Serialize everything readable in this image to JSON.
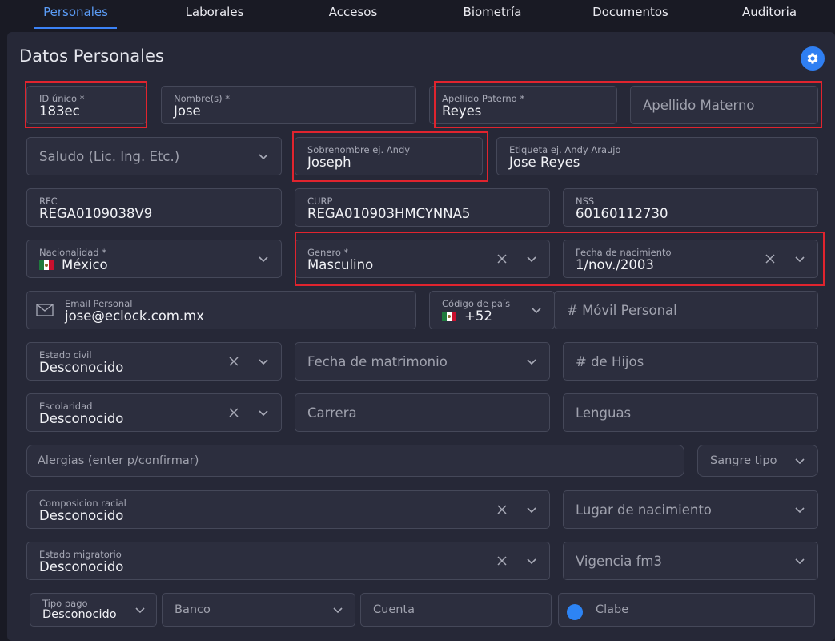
{
  "tabs": [
    {
      "label": "Personales",
      "active": true
    },
    {
      "label": "Laborales"
    },
    {
      "label": "Accesos"
    },
    {
      "label": "Biometría"
    },
    {
      "label": "Documentos"
    },
    {
      "label": "Auditoria"
    }
  ],
  "section": {
    "title": "Datos Personales",
    "settings_icon": "gear-icon"
  },
  "fields": {
    "id_unico": {
      "label": "ID único *",
      "value": "183ec"
    },
    "nombres": {
      "label": "Nombre(s) *",
      "value": "Jose"
    },
    "apellido_paterno": {
      "label": "Apellido Paterno *",
      "value": "Reyes"
    },
    "apellido_materno": {
      "placeholder": "Apellido Materno"
    },
    "saludo": {
      "placeholder": "Saludo (Lic. Ing. Etc.)"
    },
    "sobrenombre": {
      "label": "Sobrenombre ej. Andy",
      "value": "Joseph"
    },
    "etiqueta": {
      "label": "Etiqueta ej. Andy Araujo",
      "value": "Jose Reyes"
    },
    "rfc": {
      "label": "RFC",
      "value": "REGA0109038V9"
    },
    "curp": {
      "label": "CURP",
      "value": "REGA010903HMCYNNA5"
    },
    "nss": {
      "label": "NSS",
      "value": "60160112730"
    },
    "nacionalidad": {
      "label": "Nacionalidad *",
      "value": "México"
    },
    "genero": {
      "label": "Genero *",
      "value": "Masculino"
    },
    "fecha_nacimiento": {
      "label": "Fecha de nacimiento",
      "value": "1/nov./2003"
    },
    "email": {
      "label": "Email Personal",
      "value": "jose@eclock.com.mx"
    },
    "codigo_pais": {
      "label": "Código de país",
      "value": "+52"
    },
    "movil": {
      "placeholder": "# Móvil Personal"
    },
    "estado_civil": {
      "label": "Estado civil",
      "value": "Desconocido"
    },
    "fecha_matrimonio": {
      "placeholder": "Fecha de matrimonio"
    },
    "hijos": {
      "placeholder": "# de Hijos"
    },
    "escolaridad": {
      "label": "Escolaridad",
      "value": "Desconocido"
    },
    "carrera": {
      "placeholder": "Carrera"
    },
    "lenguas": {
      "placeholder": "Lenguas"
    },
    "alergias": {
      "placeholder": "Alergias (enter p/confirmar)"
    },
    "sangre": {
      "placeholder": "Sangre tipo"
    },
    "composicion": {
      "label": "Composicion racial",
      "value": "Desconocido"
    },
    "lugar_nacimiento": {
      "placeholder": "Lugar de nacimiento"
    },
    "estado_migratorio": {
      "label": "Estado migratorio",
      "value": "Desconocido"
    },
    "vigencia": {
      "placeholder": "Vigencia fm3"
    },
    "tipo_pago": {
      "label": "Tipo pago",
      "value": "Desconocido"
    },
    "banco": {
      "placeholder": "Banco"
    },
    "cuenta": {
      "placeholder": "Cuenta"
    },
    "clabe": {
      "placeholder": "Clabe"
    }
  },
  "colors": {
    "accent": "#3b82f6",
    "highlight": "#e0242e",
    "background": "#191a24",
    "panel": "#262837",
    "field": "#2c2e3e"
  }
}
